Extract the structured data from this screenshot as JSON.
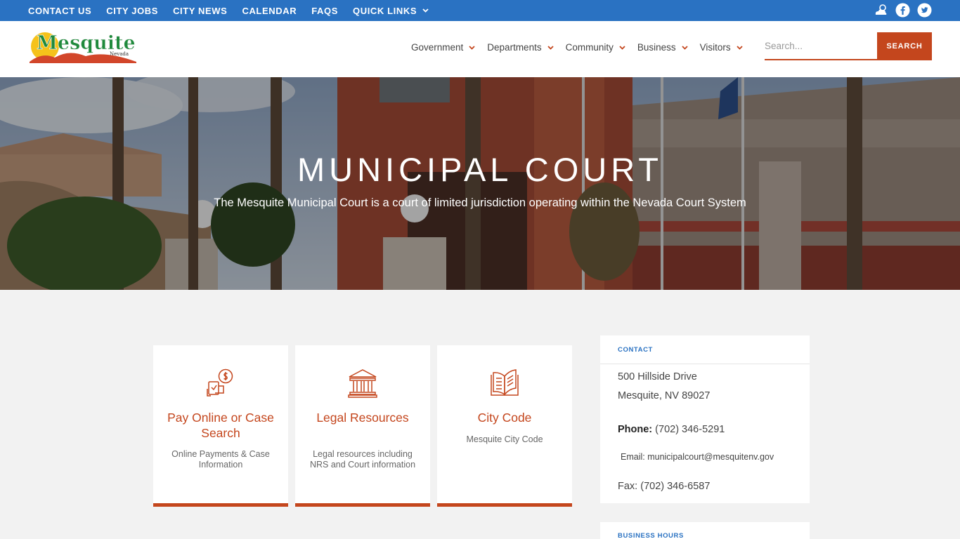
{
  "topbar": {
    "links": [
      "CONTACT US",
      "CITY JOBS",
      "CITY NEWS",
      "CALENDAR",
      "FAQS",
      "QUICK LINKS"
    ],
    "icons": [
      "weather-icon",
      "facebook-icon",
      "twitter-icon"
    ]
  },
  "header": {
    "logo_text": "Mesquite",
    "logo_sub": "Nevada",
    "nav": [
      "Government",
      "Departments",
      "Community",
      "Business",
      "Visitors"
    ],
    "search_placeholder": "Search...",
    "search_button": "SEARCH"
  },
  "hero": {
    "title": "MUNICIPAL COURT",
    "subtitle": "The Mesquite Municipal Court is a court of limited jurisdiction operating within the Nevada Court System"
  },
  "cards": [
    {
      "title": "Pay Online or Case Search",
      "desc": "Online Payments & Case Information",
      "icon": "online-payment-icon"
    },
    {
      "title": "Legal Resources",
      "desc": "Legal resources including NRS and Court information",
      "icon": "courthouse-icon"
    },
    {
      "title": "City Code",
      "desc": "Mesquite City Code",
      "icon": "open-book-icon"
    }
  ],
  "contact": {
    "heading": "CONTACT",
    "address1": "500 Hillside Drive",
    "address2": "Mesquite, NV 89027",
    "phone_label": "Phone:",
    "phone": "(702) 346-5291",
    "email_label": "Email:",
    "email": "municipalcourt@mesquitenv.gov",
    "fax_label": "Fax:",
    "fax": "(702) 346-6587"
  },
  "hours": {
    "heading": "BUSINESS HOURS"
  },
  "colors": {
    "brand_blue": "#2a72c2",
    "accent_orange": "#c4461d"
  }
}
